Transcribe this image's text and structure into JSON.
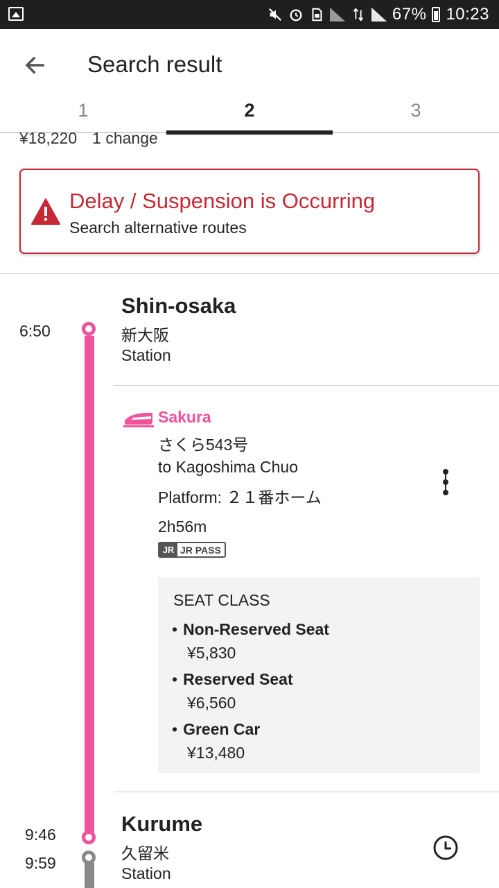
{
  "status_bar": {
    "battery": "67%",
    "time": "10:23"
  },
  "header": {
    "title": "Search result"
  },
  "tabs": [
    {
      "label": "1",
      "active": false
    },
    {
      "label": "2",
      "active": true
    },
    {
      "label": "3",
      "active": false
    }
  ],
  "summary": {
    "fare": "¥18,220",
    "changes": "1 change"
  },
  "alert": {
    "title": "Delay / Suspension is Occurring",
    "subtitle": "Search alternative routes",
    "color": "#c62835"
  },
  "origin": {
    "time": "6:50",
    "name": "Shin-osaka",
    "name_ja": "新大阪",
    "type": "Station"
  },
  "train": {
    "name": "Sakura",
    "number": "さくら543号",
    "destination": "to Kagoshima Chuo",
    "platform": "Platform: ２１番ホーム",
    "duration": "2h56m",
    "badge_jr": "JR",
    "badge_pass": "JR PASS",
    "color": "#f0529c",
    "seat_class": {
      "title": "SEAT CLASS",
      "items": [
        {
          "name": "Non-Reserved Seat",
          "price": "¥5,830"
        },
        {
          "name": "Reserved Seat",
          "price": "¥6,560"
        },
        {
          "name": "Green Car",
          "price": "¥13,480"
        }
      ]
    }
  },
  "destination": {
    "arrive_time": "9:46",
    "depart_time": "9:59",
    "name": "Kurume",
    "name_ja": "久留米",
    "type": "Station"
  }
}
